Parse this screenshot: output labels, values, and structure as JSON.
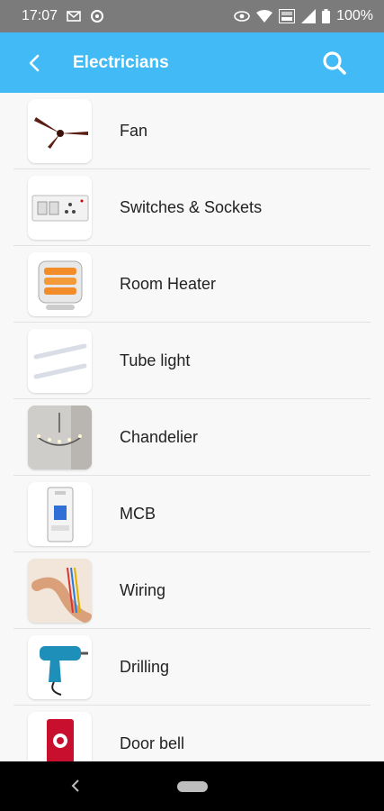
{
  "status_bar": {
    "time": "17:07",
    "battery": "100%"
  },
  "app_bar": {
    "title": "Electricians",
    "back_icon": "arrow-back-icon",
    "search_icon": "search-icon"
  },
  "items": [
    {
      "label": "Fan"
    },
    {
      "label": "Switches & Sockets"
    },
    {
      "label": "Room Heater"
    },
    {
      "label": "Tube light"
    },
    {
      "label": "Chandelier"
    },
    {
      "label": "MCB"
    },
    {
      "label": "Wiring"
    },
    {
      "label": "Drilling"
    },
    {
      "label": "Door bell"
    }
  ],
  "colors": {
    "app_bar": "#42baf5",
    "status_bar": "#7b7b7b",
    "background": "#f8f8f8"
  }
}
